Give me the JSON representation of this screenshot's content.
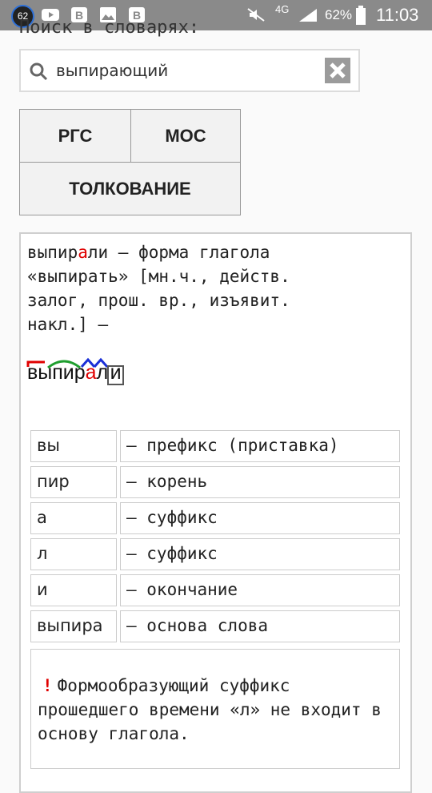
{
  "status_bar": {
    "notification_count": "62",
    "network": "4G",
    "battery": "62%",
    "time": "11:03",
    "icons": [
      "youtube-icon",
      "vk-icon",
      "gallery-icon",
      "vk-icon",
      "mute-icon",
      "signal-icon",
      "battery-icon"
    ]
  },
  "page": {
    "heading": "Поиск в словарях:"
  },
  "search": {
    "value": "выпирающий",
    "placeholder": ""
  },
  "buttons": {
    "rgs": "РГС",
    "mos": "МОС",
    "tolk": "ТОЛКОВАНИЕ"
  },
  "result": {
    "line1_pre": "выпир",
    "line1_accent": "а",
    "line1_post": "ли – форма глагола",
    "lines_rest": "«выпирать» [мн.ч., действ.\nзалог, прош. вр., изъявит.\nнакл.] –",
    "morph_word_pre": "выпир",
    "morph_word_accent": "а",
    "morph_word_l": "л",
    "morph_word_ending": "и"
  },
  "morphemes": [
    {
      "part": "вы",
      "desc": "– префикс (приставка)"
    },
    {
      "part": "пир",
      "desc": "– корень"
    },
    {
      "part": "а",
      "desc": "– суффикс"
    },
    {
      "part": "л",
      "desc": "– суффикс"
    },
    {
      "part": "и",
      "desc": "– окончание"
    },
    {
      "part": "выпира",
      "desc": "– основа слова"
    }
  ],
  "note": {
    "mark": "!",
    "text": "Формообразующий суффикс прошедшего времени «л» не входит в основу глагола."
  },
  "colors": {
    "status_bar": "#8a8a8a",
    "accent_red": "#e00000",
    "root_green": "#1e9e2e",
    "suffix_blue": "#1a2fd6"
  }
}
